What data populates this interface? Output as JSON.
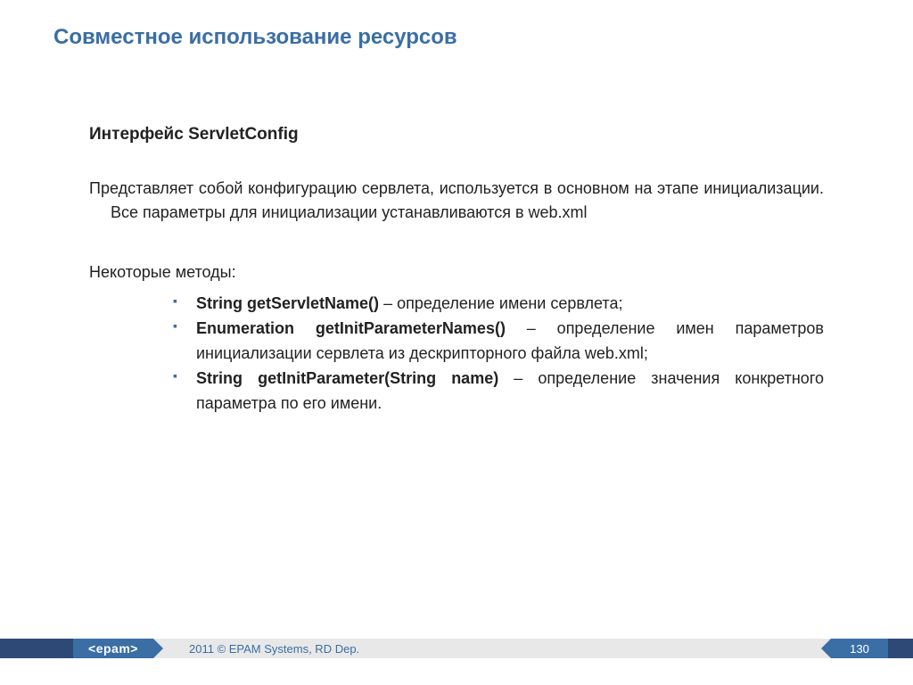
{
  "title": "Совместное использование ресурсов",
  "subtitle": "Интерфейс ServletConfig",
  "paragraph": "Представляет собой конфигурацию сервлета, используется в основном на этапе инициализации. Все параметры для инициализации устанавливаются в web.xml",
  "methods_intro": "Некоторые методы:",
  "methods": [
    {
      "sig": "String getServletName()",
      "desc": " – определение имени сервлета;"
    },
    {
      "sig": "Enumeration getInitParameterNames()",
      "desc": " – определение имен параметров инициализации сервлета из дескрипторного файла web.xml;"
    },
    {
      "sig": "String getInitParameter(String name)",
      "desc": " – определение значения конкретного параметра по его имени."
    }
  ],
  "footer": {
    "logo": "<epam>",
    "copyright": "2011 © EPAM Systems, RD Dep.",
    "page": "130"
  }
}
